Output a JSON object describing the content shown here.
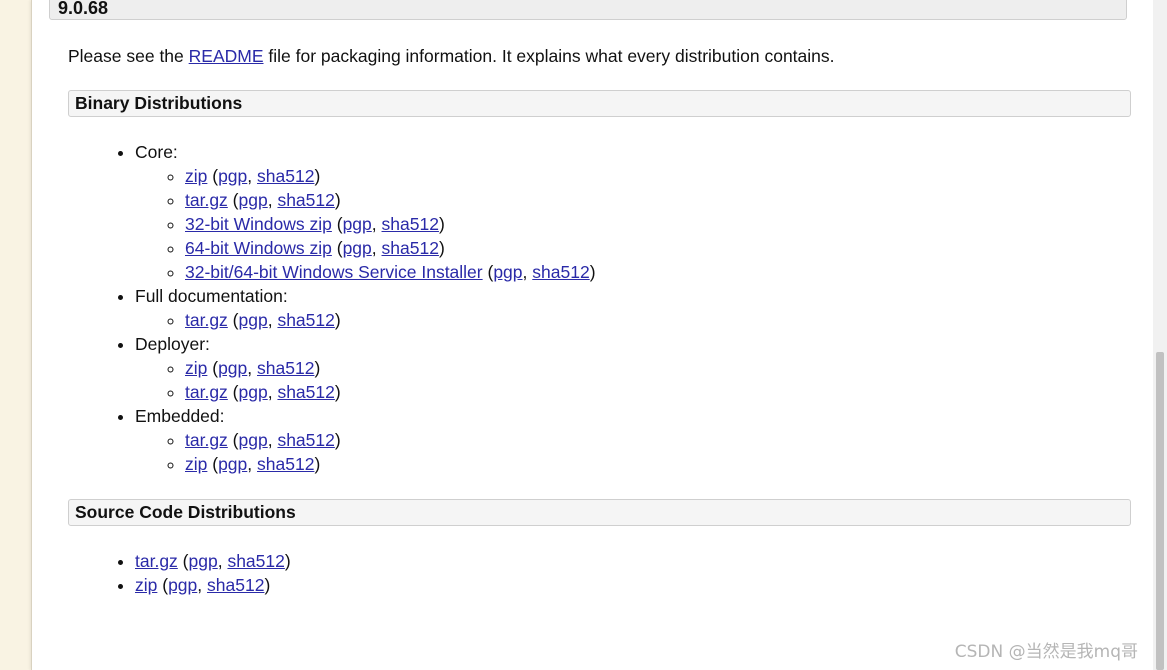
{
  "version_title": "9.0.68",
  "intro": {
    "prefix": "Please see the ",
    "link": "README",
    "suffix": " file for packaging information. It explains what every distribution contains."
  },
  "binary": {
    "heading": "Binary Distributions",
    "groups": [
      {
        "label": "Core:",
        "items": [
          {
            "name": "zip",
            "pgp": "pgp",
            "sha": "sha512"
          },
          {
            "name": "tar.gz",
            "pgp": "pgp",
            "sha": "sha512"
          },
          {
            "name": "32-bit Windows zip",
            "pgp": "pgp",
            "sha": "sha512"
          },
          {
            "name": "64-bit Windows zip",
            "pgp": "pgp",
            "sha": "sha512"
          },
          {
            "name": "32-bit/64-bit Windows Service Installer",
            "pgp": "pgp",
            "sha": "sha512"
          }
        ]
      },
      {
        "label": "Full documentation:",
        "items": [
          {
            "name": "tar.gz",
            "pgp": "pgp",
            "sha": "sha512"
          }
        ]
      },
      {
        "label": "Deployer:",
        "items": [
          {
            "name": "zip",
            "pgp": "pgp",
            "sha": "sha512"
          },
          {
            "name": "tar.gz",
            "pgp": "pgp",
            "sha": "sha512"
          }
        ]
      },
      {
        "label": "Embedded:",
        "items": [
          {
            "name": "tar.gz",
            "pgp": "pgp",
            "sha": "sha512"
          },
          {
            "name": "zip",
            "pgp": "pgp",
            "sha": "sha512"
          }
        ]
      }
    ]
  },
  "source": {
    "heading": "Source Code Distributions",
    "items": [
      {
        "name": "tar.gz",
        "pgp": "pgp",
        "sha": "sha512"
      },
      {
        "name": "zip",
        "pgp": "pgp",
        "sha": "sha512"
      }
    ]
  },
  "watermark": "CSDN @当然是我mq哥"
}
